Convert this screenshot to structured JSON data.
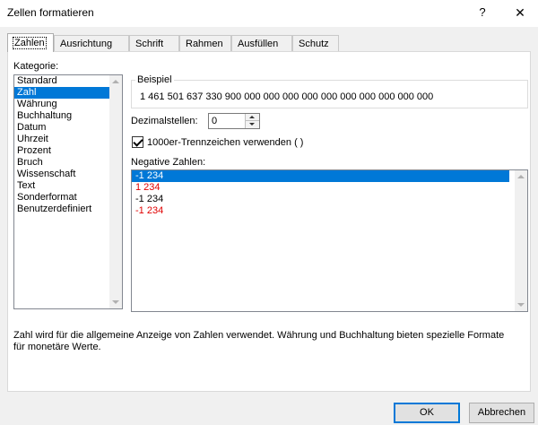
{
  "window": {
    "title": "Zellen formatieren",
    "help": "?",
    "close": "✕"
  },
  "tabs": [
    "Zahlen",
    "Ausrichtung",
    "Schrift",
    "Rahmen",
    "Ausfüllen",
    "Schutz"
  ],
  "category": {
    "label": "Kategorie:",
    "items": [
      "Standard",
      "Zahl",
      "Währung",
      "Buchhaltung",
      "Datum",
      "Uhrzeit",
      "Prozent",
      "Bruch",
      "Wissenschaft",
      "Text",
      "Sonderformat",
      "Benutzerdefiniert"
    ],
    "selected": "Zahl"
  },
  "sample": {
    "label": "Beispiel",
    "value": "1 461 501 637 330 900 000 000 000 000 000 000 000 000 000 000"
  },
  "decimals": {
    "label": "Dezimalstellen:",
    "value": "0"
  },
  "thousands": {
    "label": "1000er-Trennzeichen verwenden ( )",
    "checked": true
  },
  "negative": {
    "label": "Negative Zahlen:",
    "items": [
      {
        "text": "-1 234",
        "color": "#ffffff",
        "selected": true
      },
      {
        "text": "1 234",
        "color": "#e00000"
      },
      {
        "text": "-1 234",
        "color": "#000000"
      },
      {
        "text": "-1 234",
        "color": "#e00000"
      }
    ]
  },
  "description": "Zahl wird für die allgemeine Anzeige von Zahlen verwendet. Währung und Buchhaltung bieten spezielle Formate für monetäre Werte.",
  "buttons": {
    "ok": "OK",
    "cancel": "Abbrechen"
  },
  "colors": {
    "selection": "#0078d7",
    "negative_red": "#e00000",
    "dialog_bg": "#f0f0f0"
  }
}
